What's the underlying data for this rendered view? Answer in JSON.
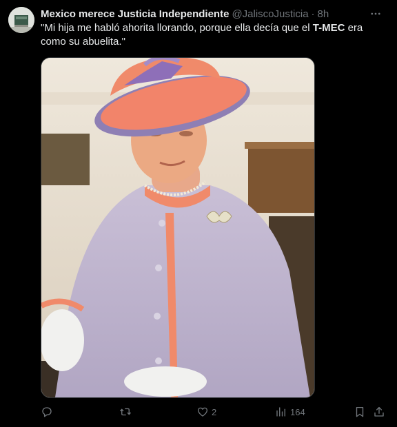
{
  "post": {
    "author": {
      "display_name": "Mexico merece Justicia Independiente",
      "handle": "@JaliscoJusticia",
      "separator": "·",
      "time": "8h"
    },
    "text": {
      "before": "\"Mi hija me habló ahorita llorando, porque ella decía que el ",
      "bold": "T-MEC",
      "after": " era como su abuelita.\""
    },
    "metrics": {
      "replies": "",
      "reposts": "",
      "likes": "2",
      "views": "164"
    }
  },
  "icons": {
    "more": "more-horizontal-icon",
    "reply": "reply-icon",
    "repost": "repost-icon",
    "like": "heart-icon",
    "views": "views-chart-icon",
    "bookmark": "bookmark-icon",
    "share": "share-icon"
  },
  "colors": {
    "background": "#000000",
    "text": "#e7e9ea",
    "muted": "#71767b"
  }
}
